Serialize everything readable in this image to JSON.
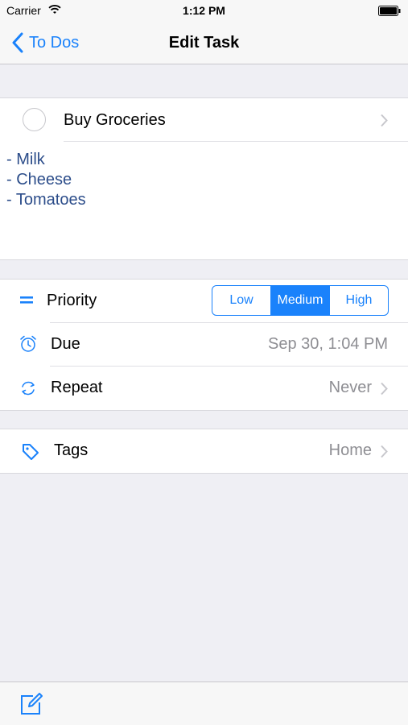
{
  "status_bar": {
    "carrier": "Carrier",
    "time": "1:12 PM"
  },
  "nav": {
    "back_label": "To Dos",
    "title": "Edit Task"
  },
  "task": {
    "title": "Buy Groceries",
    "notes": [
      "- Milk",
      "- Cheese",
      "- Tomatoes"
    ]
  },
  "priority": {
    "label": "Priority",
    "options": [
      "Low",
      "Medium",
      "High"
    ],
    "selected": "Medium"
  },
  "due": {
    "label": "Due",
    "value": "Sep 30, 1:04 PM"
  },
  "repeat": {
    "label": "Repeat",
    "value": "Never"
  },
  "tags": {
    "label": "Tags",
    "value": "Home"
  },
  "colors": {
    "accent": "#1a82fb",
    "notes_text": "#2c4d8a",
    "secondary_text": "#8e8e93"
  },
  "icons": {
    "back": "chevron-left-icon",
    "priority": "menu-lines-icon",
    "due": "alarm-clock-icon",
    "repeat": "repeat-icon",
    "tags": "tag-icon",
    "compose": "compose-icon"
  }
}
